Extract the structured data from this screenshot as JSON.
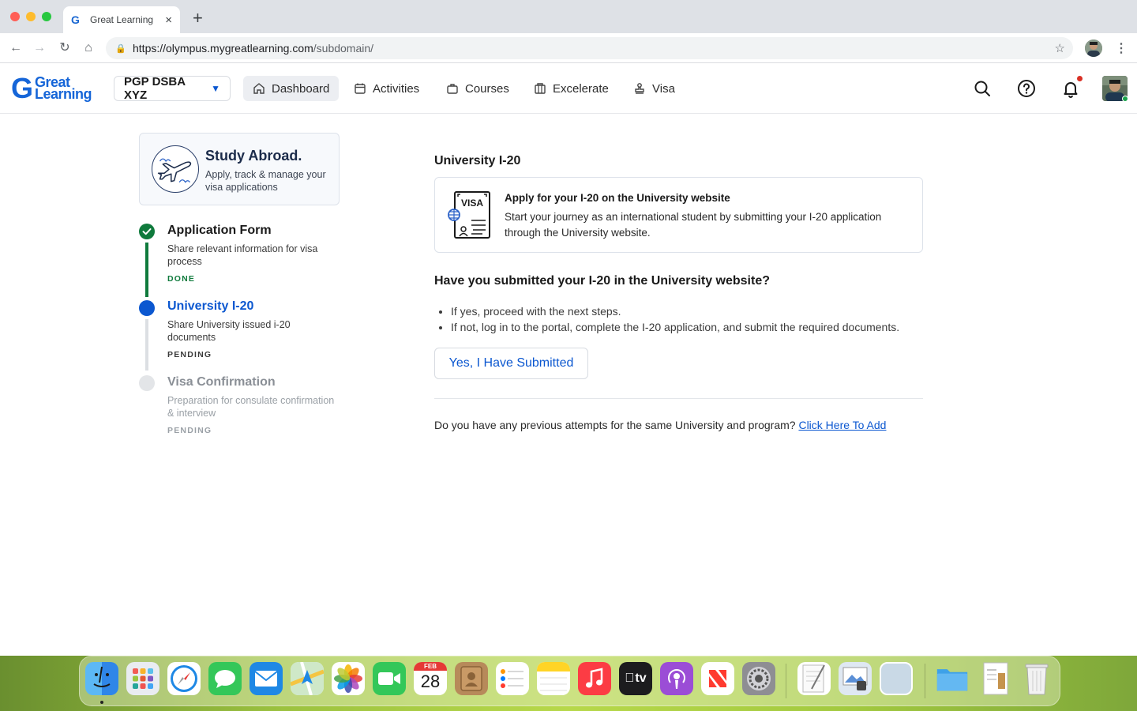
{
  "browser": {
    "tab_title": "Great Learning",
    "tab_close": "×",
    "new_tab": "+",
    "url_host": "https://olympus.mygreatlearning.com",
    "url_path": "/subdomain/"
  },
  "header": {
    "logo_line1": "Great",
    "logo_line2": "Learning",
    "program": "PGP DSBA XYZ",
    "nav": [
      {
        "label": "Dashboard",
        "icon": "home-icon"
      },
      {
        "label": "Activities",
        "icon": "calendar-icon"
      },
      {
        "label": "Courses",
        "icon": "briefcase-icon"
      },
      {
        "label": "Excelerate",
        "icon": "building-icon"
      },
      {
        "label": "Visa",
        "icon": "stamp-icon"
      }
    ],
    "active_nav": "Dashboard"
  },
  "sidebar": {
    "card_title": "Study Abroad.",
    "card_subtitle": "Apply, track & manage your visa applications",
    "steps": [
      {
        "title": "Application Form",
        "desc": "Share relevant information for visa process",
        "status": "DONE"
      },
      {
        "title": "University I-20",
        "desc": "Share University issued i-20 documents",
        "status": "PENDING"
      },
      {
        "title": "Visa Confirmation",
        "desc": "Preparation for consulate confirmation & interview",
        "status": "PENDING"
      }
    ]
  },
  "main": {
    "section_title": "University I-20",
    "info_title": "Apply for your I-20 on the University website",
    "info_desc": "Start your journey as an international student by submitting your I-20 application through the University website.",
    "visa_label": "VISA",
    "question": "Have you submitted your I-20 in the University website?",
    "bullets": [
      "If yes, proceed with the next steps.",
      "If not, log in to the portal, complete the I-20 application, and submit the required documents."
    ],
    "submit_button": "Yes, I Have Submitted",
    "prev_attempts_text": "Do you have any previous attempts for the same University and program?",
    "prev_attempts_link": "Click Here To Add"
  },
  "dock": {
    "calendar_month": "FEB",
    "calendar_day": "28",
    "tv_label": "tv"
  },
  "colors": {
    "brand_blue": "#0b57d0",
    "done_green": "#0f7a3c",
    "pending_gray": "#cfd3d8"
  }
}
